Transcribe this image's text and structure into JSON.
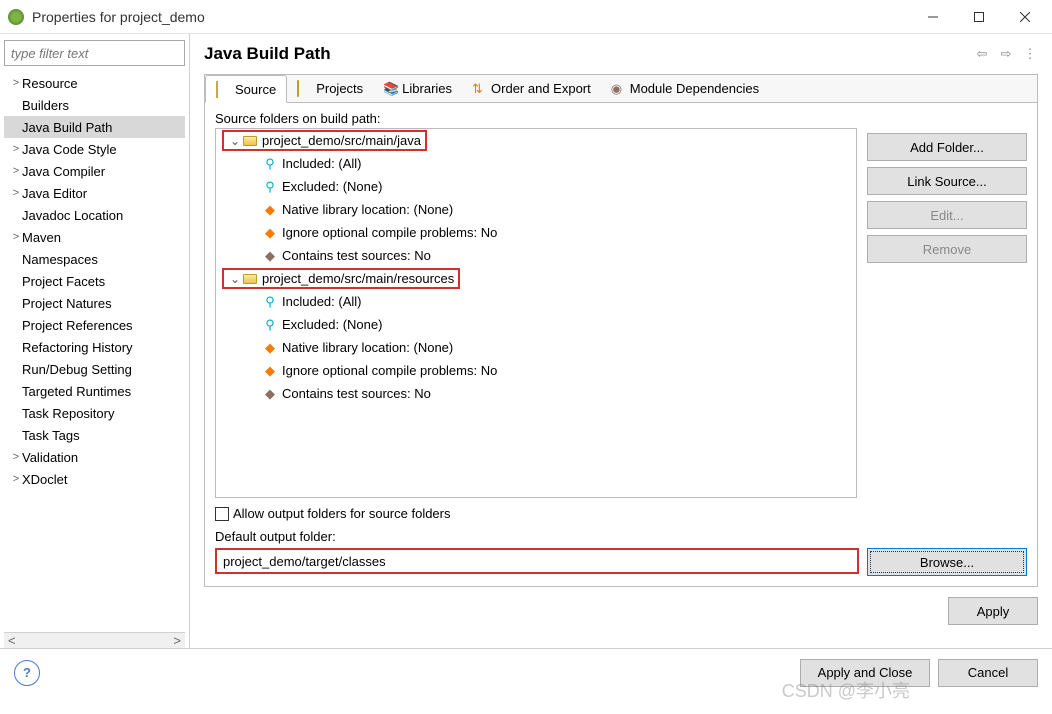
{
  "window": {
    "title": "Properties for project_demo"
  },
  "filter": {
    "placeholder": "type filter text"
  },
  "leftTree": [
    {
      "label": "Resource",
      "expandable": true
    },
    {
      "label": "Builders",
      "expandable": false
    },
    {
      "label": "Java Build Path",
      "expandable": false,
      "selected": true
    },
    {
      "label": "Java Code Style",
      "expandable": true
    },
    {
      "label": "Java Compiler",
      "expandable": true
    },
    {
      "label": "Java Editor",
      "expandable": true
    },
    {
      "label": "Javadoc Location",
      "expandable": false
    },
    {
      "label": "Maven",
      "expandable": true
    },
    {
      "label": "Namespaces",
      "expandable": false
    },
    {
      "label": "Project Facets",
      "expandable": false
    },
    {
      "label": "Project Natures",
      "expandable": false
    },
    {
      "label": "Project References",
      "expandable": false
    },
    {
      "label": "Refactoring History",
      "expandable": false
    },
    {
      "label": "Run/Debug Setting",
      "expandable": false
    },
    {
      "label": "Targeted Runtimes",
      "expandable": false
    },
    {
      "label": "Task Repository",
      "expandable": false
    },
    {
      "label": "Task Tags",
      "expandable": false
    },
    {
      "label": "Validation",
      "expandable": true
    },
    {
      "label": "XDoclet",
      "expandable": true
    }
  ],
  "page": {
    "title": "Java Build Path"
  },
  "tabs": {
    "source": "Source",
    "projects": "Projects",
    "libraries": "Libraries",
    "order": "Order and Export",
    "module": "Module Dependencies"
  },
  "source": {
    "heading": "Source folders on build path:",
    "folders": [
      {
        "path": "project_demo/src/main/java",
        "details": [
          "Included: (All)",
          "Excluded: (None)",
          "Native library location: (None)",
          "Ignore optional compile problems: No",
          "Contains test sources: No"
        ]
      },
      {
        "path": "project_demo/src/main/resources",
        "details": [
          "Included: (All)",
          "Excluded: (None)",
          "Native library location: (None)",
          "Ignore optional compile problems: No",
          "Contains test sources: No"
        ]
      }
    ],
    "allowOutput": "Allow output folders for source folders",
    "defaultOutputLabel": "Default output folder:",
    "defaultOutput": "project_demo/target/classes"
  },
  "buttons": {
    "addFolder": "Add Folder...",
    "linkSource": "Link Source...",
    "edit": "Edit...",
    "remove": "Remove",
    "browse": "Browse...",
    "apply": "Apply",
    "applyClose": "Apply and Close",
    "cancel": "Cancel"
  },
  "watermark": "CSDN @李小亮"
}
